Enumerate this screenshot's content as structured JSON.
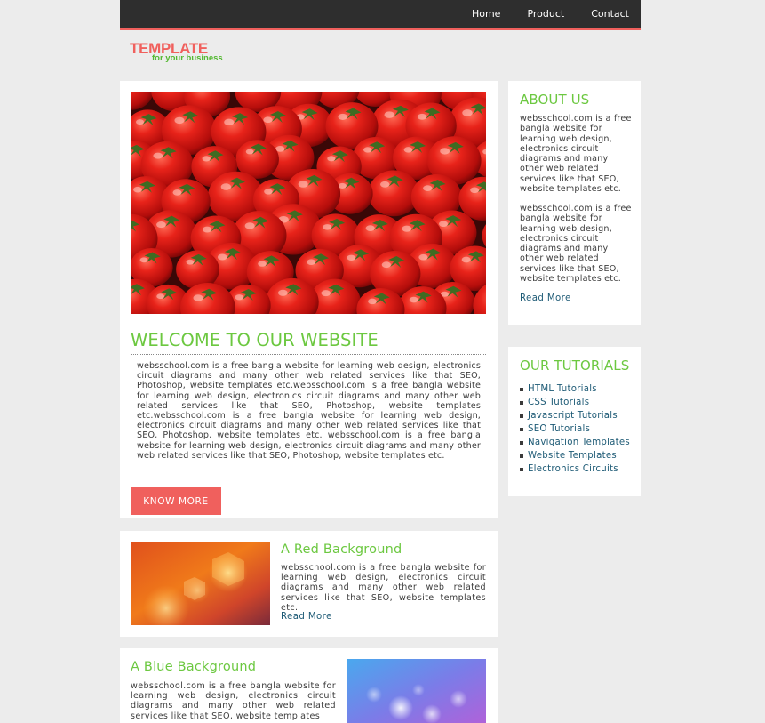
{
  "nav": {
    "items": [
      "Home",
      "Product",
      "Contact"
    ]
  },
  "logo": {
    "line1": "TEMPLATE",
    "line2": "for your business"
  },
  "main": {
    "title": "WELCOME TO OUR WEBSITE",
    "text": "websschool.com is a free bangla website for learning web design, electronics circuit diagrams and many other web related services like that SEO, Photoshop, website templates etc.websschool.com is a free bangla website for learning web design, electronics circuit diagrams and many other web related services like that SEO, Photoshop, website templates etc.websschool.com is a free bangla website for learning web design, electronics circuit diagrams and many other web related services like that SEO, Photoshop, website templates etc. websschool.com is a free bangla website for learning web design, electronics circuit diagrams and many other web related services like that SEO, Photoshop, website templates etc.",
    "button": "KNOW MORE"
  },
  "features": [
    {
      "title": "A Red Background",
      "text": "websschool.com is a free bangla website for learning web design, electronics circuit diagrams and many other web related services like that SEO, website templates etc.",
      "link": "Read More"
    },
    {
      "title": "A Blue Background",
      "text": "websschool.com is a free bangla website for learning web design, electronics circuit diagrams and many other web related services like that SEO, website templates"
    }
  ],
  "about": {
    "title": "ABOUT US",
    "para1": "websschool.com is a free bangla website for learning web design, electronics circuit diagrams and many other web related services like that SEO, website templates etc.",
    "para2": "websschool.com is a free bangla website for learning web design, electronics circuit diagrams and many other web related services like that SEO, website templates etc.",
    "link": "Read More"
  },
  "tutorials": {
    "title": "OUR TUTORIALS",
    "items": [
      "HTML Tutorials",
      "CSS Tutorials",
      "Javascript Tutorials",
      "SEO Tutorials",
      "Navigation Templates",
      "Website Templates",
      "Electronics Circuits"
    ]
  },
  "colors": {
    "accent": "#f0605d",
    "heading_green": "#6cc840",
    "link": "#1d5a75",
    "topbar": "#2e2e2e",
    "background": "#ececec"
  }
}
